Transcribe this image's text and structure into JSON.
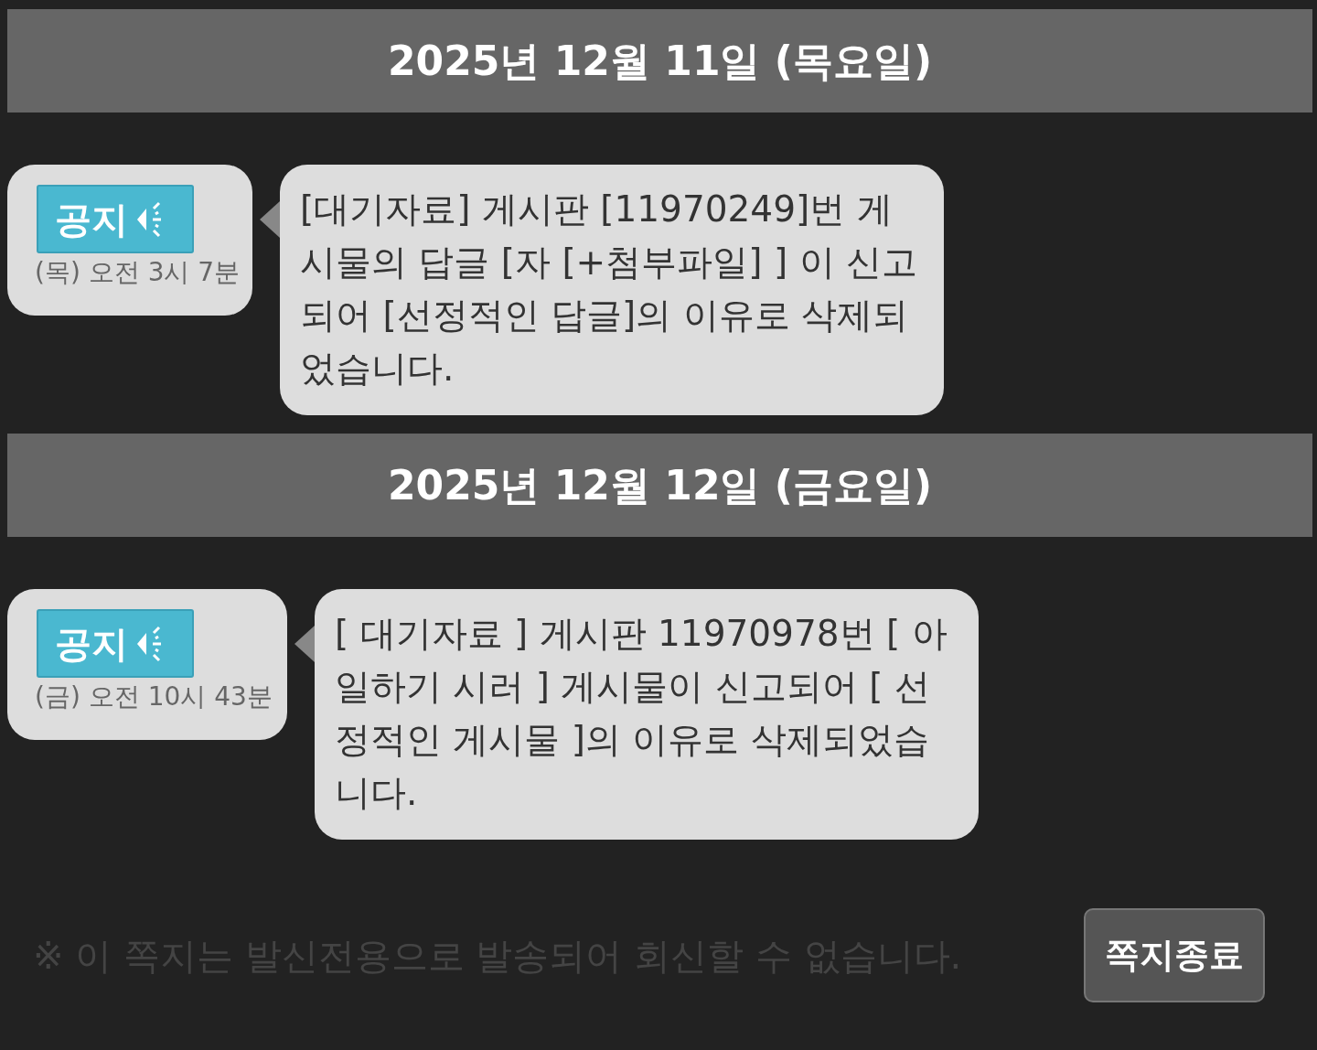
{
  "days": [
    {
      "date": "2025년 12월 11일 (목요일)",
      "messages": [
        {
          "badge": "공지",
          "time": "(목) 오전 3시 7분",
          "text": "[대기자료] 게시판 [11970249]번 게시물의 답글 [자 [+첨부파일] ] 이 신고되어 [선정적인 답글]의 이유로 삭제되었습니다."
        }
      ]
    },
    {
      "date": "2025년 12월 12일 (금요일)",
      "messages": [
        {
          "badge": "공지",
          "time": "(금) 오전 10시 43분",
          "text": "[ 대기자료 ] 게시판 11970978번 [ 아 일하기 시러 ] 게시물이 신고되어 [ 선정적인 게시물 ]의 이유로 삭제되었습니다."
        }
      ]
    }
  ],
  "footer": {
    "notice": "※ 이 쪽지는 발신전용으로 발송되어 회신할 수 없습니다.",
    "close_button": "쪽지종료"
  }
}
